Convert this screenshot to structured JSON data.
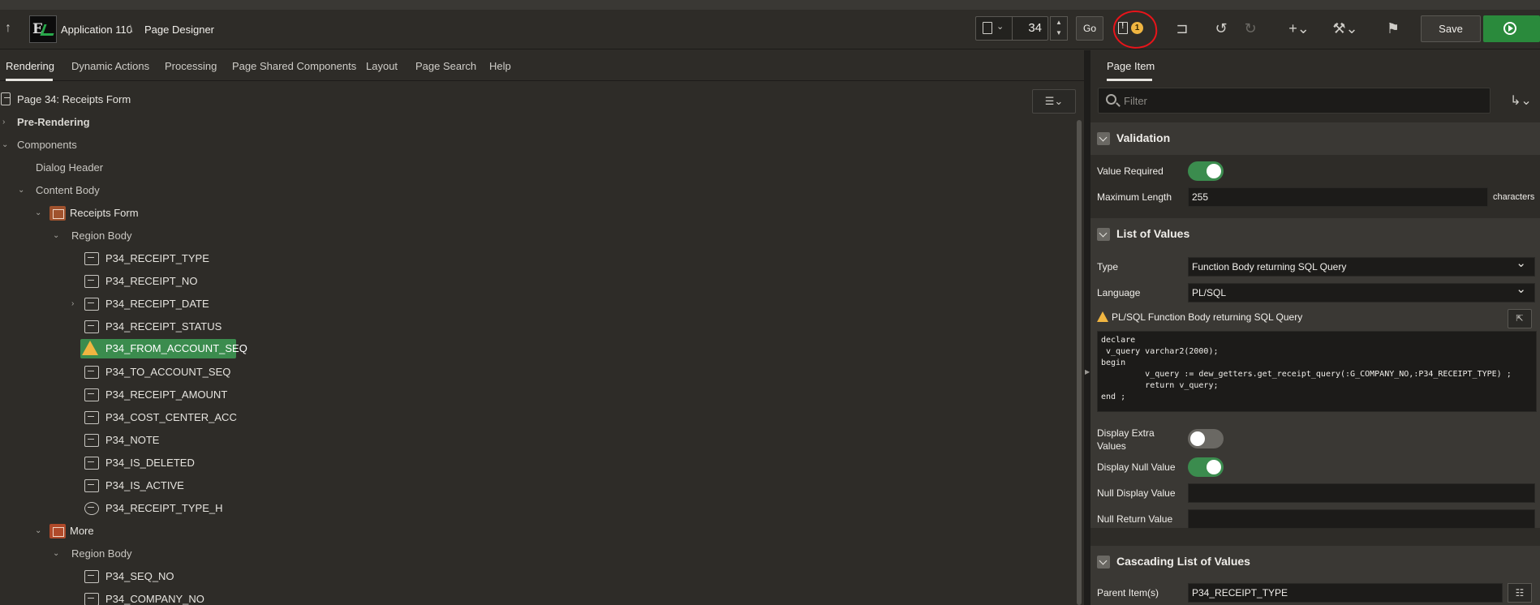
{
  "header": {
    "app_name": "Application 110",
    "separator": "\\",
    "page_name": "Page Designer",
    "page_number": "34",
    "go_label": "Go",
    "warning_count": "1",
    "save_label": "Save"
  },
  "tabs": [
    {
      "label": "Rendering",
      "active": true
    },
    {
      "label": "Dynamic Actions"
    },
    {
      "label": "Processing"
    },
    {
      "label": "Page Shared Components"
    },
    {
      "label": "Layout"
    },
    {
      "label": "Page Search"
    },
    {
      "label": "Help"
    }
  ],
  "tree": {
    "page": "Page 34: Receipts Form",
    "pre_rendering": "Pre-Rendering",
    "components": "Components",
    "dialog_header": "Dialog Header",
    "content_body": "Content Body",
    "receipts_form": "Receipts Form",
    "region_body_1": "Region Body",
    "items": [
      "P34_RECEIPT_TYPE",
      "P34_RECEIPT_NO",
      "P34_RECEIPT_DATE",
      "P34_RECEIPT_STATUS",
      "P34_FROM_ACCOUNT_SEQ",
      "P34_TO_ACCOUNT_SEQ",
      "P34_RECEIPT_AMOUNT",
      "P34_COST_CENTER_ACC",
      "P34_NOTE",
      "P34_IS_DELETED",
      "P34_IS_ACTIVE",
      "P34_RECEIPT_TYPE_H"
    ],
    "more": "More",
    "region_body_2": "Region Body",
    "more_items": [
      "P34_SEQ_NO",
      "P34_COMPANY_NO"
    ]
  },
  "panel": {
    "tab": "Page Item",
    "filter_placeholder": "Filter",
    "validation": {
      "title": "Validation",
      "value_required_label": "Value Required",
      "value_required": true,
      "max_length_label": "Maximum Length",
      "max_length": "255",
      "max_length_unit": "characters"
    },
    "lov": {
      "title": "List of Values",
      "type_label": "Type",
      "type_value": "Function Body returning SQL Query",
      "language_label": "Language",
      "language_value": "PL/SQL",
      "code_label": "PL/SQL Function Body returning SQL Query",
      "code": "declare\n v_query varchar2(2000);\nbegin\n         v_query := dew_getters.get_receipt_query(:G_COMPANY_NO,:P34_RECEIPT_TYPE) ;\n         return v_query;\nend ;",
      "display_extra_label": "Display Extra Values",
      "display_extra_line1": "Display Extra",
      "display_extra_line2": "Values",
      "display_extra": false,
      "display_null_label": "Display Null Value",
      "display_null": true,
      "null_display_label": "Null Display Value",
      "null_display_value": "",
      "null_return_label": "Null Return Value",
      "null_return_value": ""
    },
    "cascading": {
      "title": "Cascading List of Values",
      "parent_label": "Parent Item(s)",
      "parent_value": "P34_RECEIPT_TYPE"
    }
  },
  "colors": {
    "accent_green": "#3b8c4e",
    "warning": "#f0b541",
    "annotation_red": "#e8141a"
  }
}
